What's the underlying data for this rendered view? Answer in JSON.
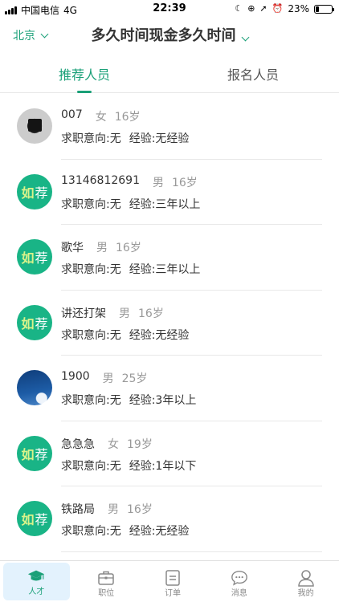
{
  "status_bar": {
    "carrier": "中国电信",
    "network": "4G",
    "time": "22:39",
    "battery": "23%",
    "battery_level": 0.23
  },
  "header": {
    "city": "北京",
    "title": "多久时间现金多久时间"
  },
  "tabs": [
    {
      "label": "推荐人员",
      "active": true
    },
    {
      "label": "报名人员",
      "active": false
    }
  ],
  "people": [
    {
      "name": "007",
      "gender": "女",
      "age": "16岁",
      "intent": "求职意向:无",
      "exp": "经验:无经验",
      "avatar": "photo-dark"
    },
    {
      "name": "13146812691",
      "gender": "男",
      "age": "16岁",
      "intent": "求职意向:无",
      "exp": "经验:三年以上",
      "avatar": "rec"
    },
    {
      "name": "歌华",
      "gender": "男",
      "age": "16岁",
      "intent": "求职意向:无",
      "exp": "经验:三年以上",
      "avatar": "rec"
    },
    {
      "name": "讲还打架",
      "gender": "男",
      "age": "16岁",
      "intent": "求职意向:无",
      "exp": "经验:无经验",
      "avatar": "rec"
    },
    {
      "name": "1900",
      "gender": "男",
      "age": "25岁",
      "intent": "求职意向:无",
      "exp": "经验:3年以上",
      "avatar": "photo-sky"
    },
    {
      "name": "急急急",
      "gender": "女",
      "age": "19岁",
      "intent": "求职意向:无",
      "exp": "经验:1年以下",
      "avatar": "rec"
    },
    {
      "name": "铁路局",
      "gender": "男",
      "age": "16岁",
      "intent": "求职意向:无",
      "exp": "经验:无经验",
      "avatar": "rec"
    }
  ],
  "recommend_badge": {
    "glyph": "如",
    "text": "荐"
  },
  "nav": [
    {
      "label": "人才",
      "icon": "graduation-cap-icon",
      "active": true
    },
    {
      "label": "职位",
      "icon": "briefcase-icon",
      "active": false
    },
    {
      "label": "订单",
      "icon": "order-list-icon",
      "active": false
    },
    {
      "label": "消息",
      "icon": "chat-bubble-icon",
      "active": false
    },
    {
      "label": "我的",
      "icon": "user-icon",
      "active": false
    }
  ],
  "colors": {
    "accent": "#1aa078",
    "avatar_green": "#19b486",
    "nav_active_bg": "#e3f2fd"
  }
}
